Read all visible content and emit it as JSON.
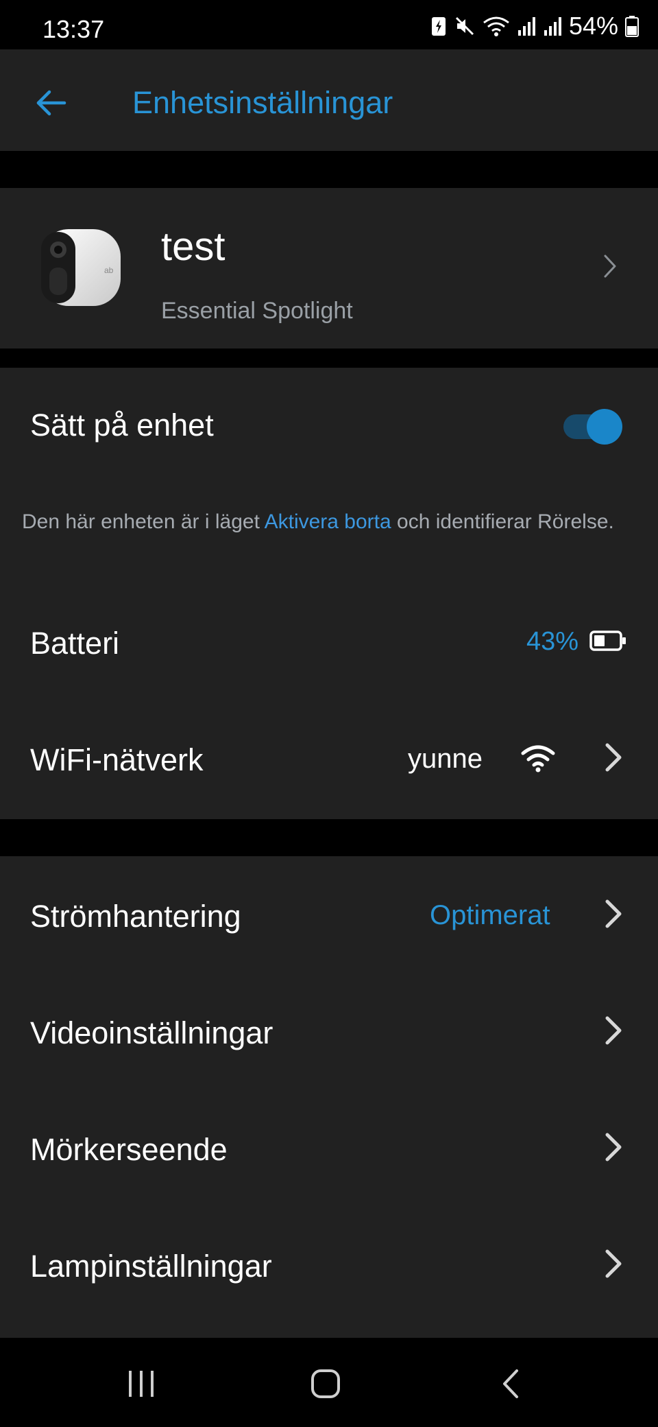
{
  "status_bar": {
    "time": "13:37",
    "battery_percent": "54%",
    "icons": [
      "battery-saver-icon",
      "mute-icon",
      "wifi-icon",
      "signal-icon",
      "signal-icon",
      "battery-icon"
    ]
  },
  "header": {
    "title": "Enhetsinställningar",
    "back_icon": "arrow-left-icon"
  },
  "device": {
    "name": "test",
    "model": "Essential Spotlight"
  },
  "power": {
    "label": "Sätt på enhet",
    "enabled": true
  },
  "mode_description": {
    "prefix": "Den här enheten är i läget ",
    "link": "Aktivera borta",
    "suffix": " och identifierar Rörelse."
  },
  "battery": {
    "label": "Batteri",
    "value": "43%",
    "level": 0.43
  },
  "wifi": {
    "label": "WiFi-nätverk",
    "network": "yunne"
  },
  "settings": {
    "power_management": {
      "label": "Strömhantering",
      "value": "Optimerat"
    },
    "video": {
      "label": "Videoinställningar"
    },
    "night_vision": {
      "label": "Mörkerseende"
    },
    "lamp": {
      "label": "Lampinställningar"
    }
  },
  "colors": {
    "accent": "#2994d6",
    "background": "#000000",
    "surface": "#212121",
    "muted_text": "#9aa0a6"
  }
}
